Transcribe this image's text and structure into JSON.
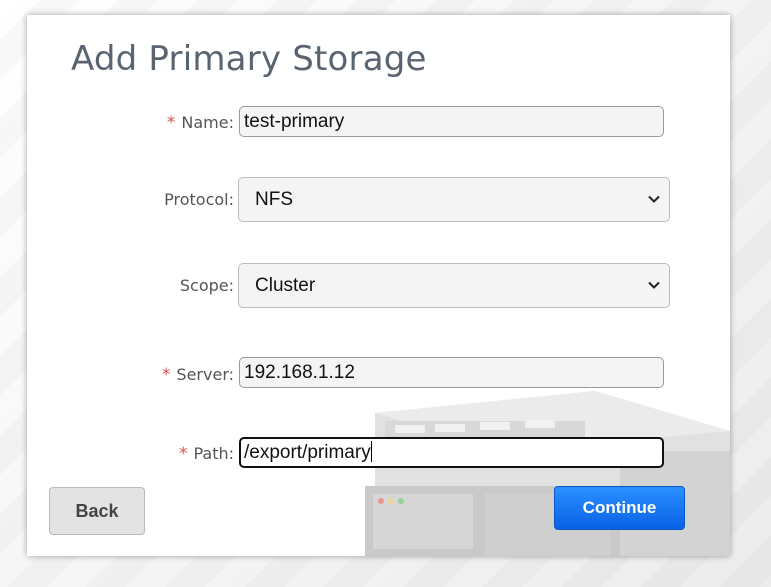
{
  "dialog": {
    "title": "Add Primary Storage"
  },
  "form": {
    "name": {
      "required_mark": "*",
      "label": "Name:",
      "value": "test-primary"
    },
    "protocol": {
      "label": "Protocol:",
      "selected": "NFS"
    },
    "scope": {
      "label": "Scope:",
      "selected": "Cluster"
    },
    "server": {
      "required_mark": "*",
      "label": "Server:",
      "value": "192.168.1.12"
    },
    "path": {
      "required_mark": "*",
      "label": "Path:",
      "value": "/export/primary"
    }
  },
  "buttons": {
    "back_label": "Back",
    "continue_label": "Continue"
  },
  "icons": {
    "select_arrow": "chevron-down-icon"
  },
  "colors": {
    "accent": "#0a62e6",
    "required": "#e0504a",
    "title": "#5a6470"
  }
}
